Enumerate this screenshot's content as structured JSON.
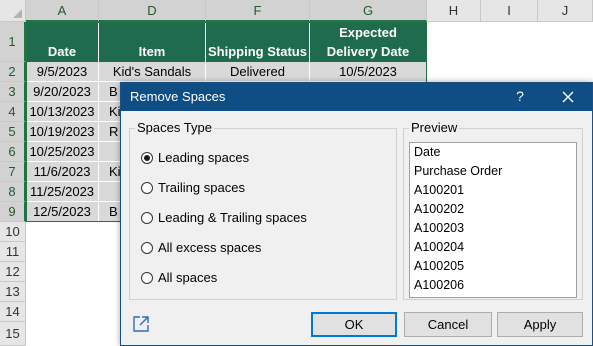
{
  "spreadsheet": {
    "columns": [
      "A",
      "D",
      "F",
      "G",
      "H",
      "I",
      "J"
    ],
    "rows": [
      "1",
      "2",
      "3",
      "4",
      "5",
      "6",
      "7",
      "8",
      "9",
      "10",
      "11",
      "12",
      "13",
      "14",
      "15"
    ],
    "header": {
      "date": "Date",
      "item": "Item",
      "status": "Shipping Status",
      "expected_1": "Expected",
      "expected_2": "Delivery Date"
    },
    "data": [
      {
        "date": "9/5/2023",
        "item": "Kid's Sandals",
        "status": "Delivered",
        "expected": "10/5/2023"
      },
      {
        "date": "9/20/2023",
        "item": "B",
        "status": "",
        "expected": ""
      },
      {
        "date": "10/13/2023",
        "item": "Ki",
        "status": "",
        "expected": ""
      },
      {
        "date": "10/19/2023",
        "item": "R",
        "status": "",
        "expected": ""
      },
      {
        "date": "10/25/2023",
        "item": "",
        "status": "",
        "expected": ""
      },
      {
        "date": "11/6/2023",
        "item": "Ki",
        "status": "",
        "expected": ""
      },
      {
        "date": "11/25/2023",
        "item": "",
        "status": "",
        "expected": ""
      },
      {
        "date": "12/5/2023",
        "item": "B",
        "status": "",
        "expected": ""
      }
    ],
    "colors": {
      "header_bg": "#1e6b4e",
      "data_bg": "#d9d9d9",
      "selection": "#217346"
    }
  },
  "dialog": {
    "title": "Remove Spaces",
    "help_label": "?",
    "spaces_type_label": "Spaces Type",
    "options": [
      {
        "label": "Leading spaces",
        "checked": true
      },
      {
        "label": "Trailing spaces",
        "checked": false
      },
      {
        "label": "Leading & Trailing spaces",
        "checked": false
      },
      {
        "label": "All excess spaces",
        "checked": false
      },
      {
        "label": "All spaces",
        "checked": false
      }
    ],
    "preview_label": "Preview",
    "preview_items": [
      "Date",
      "Purchase Order",
      "A100201",
      "A100202",
      "A100203",
      "A100204",
      "A100205",
      "A100206"
    ],
    "buttons": {
      "ok": "OK",
      "cancel": "Cancel",
      "apply": "Apply"
    },
    "colors": {
      "titlebar": "#0f4d85",
      "ok_border": "#0078d7"
    }
  }
}
